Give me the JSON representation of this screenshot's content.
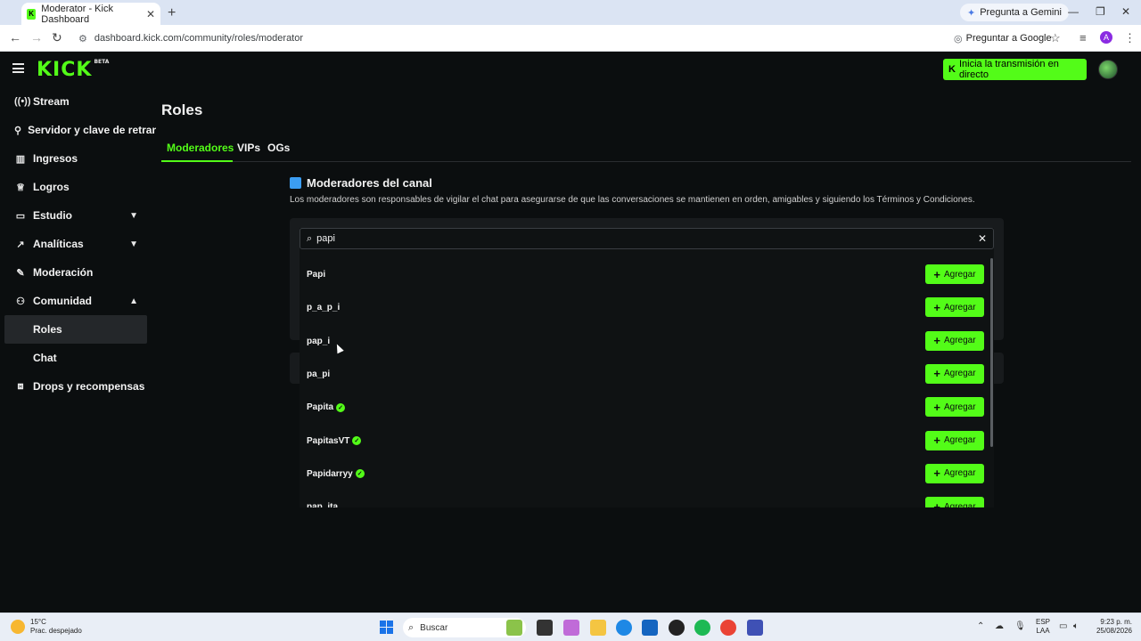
{
  "browser": {
    "tab_title": "Moderator - Kick Dashboard",
    "url": "dashboard.kick.com/community/roles/moderator",
    "gemini_label": "Pregunta a Gemini",
    "google_label": "Preguntar a Google",
    "profile_initial": "A"
  },
  "header": {
    "logo": "KICK",
    "logo_badge": "BETA",
    "stream_button": "Inicia la transmisión en directo"
  },
  "sidebar": {
    "items": [
      {
        "label": "Stream"
      },
      {
        "label": "Servidor y clave de retransmisión"
      },
      {
        "label": "Ingresos"
      },
      {
        "label": "Logros"
      },
      {
        "label": "Estudio"
      },
      {
        "label": "Analíticas"
      },
      {
        "label": "Moderación"
      },
      {
        "label": "Comunidad"
      }
    ],
    "sub_items": [
      {
        "label": "Roles"
      },
      {
        "label": "Chat"
      }
    ],
    "drops": "Drops y recompensas"
  },
  "main": {
    "title": "Roles",
    "tabs": [
      {
        "label": "Moderadores"
      },
      {
        "label": "VIPs"
      },
      {
        "label": "OGs"
      }
    ],
    "section_title": "Moderadores del canal",
    "section_desc": "Los moderadores son responsables de vigilar el chat para asegurarse de que las conversaciones se mantienen en orden, amigables y siguiendo los Términos y Condiciones."
  },
  "search": {
    "value": "papi"
  },
  "results": [
    {
      "name": "Papi",
      "verified": false
    },
    {
      "name": "p_a_p_i",
      "verified": false
    },
    {
      "name": "pap_i",
      "verified": false
    },
    {
      "name": "pa_pi",
      "verified": false
    },
    {
      "name": "Papita",
      "verified": true
    },
    {
      "name": "PapitasVT",
      "verified": true
    },
    {
      "name": "Papidarryy",
      "verified": true
    },
    {
      "name": "pap_ita",
      "verified": false
    }
  ],
  "add_label": "Agregar",
  "taskbar": {
    "temp": "15°C",
    "weather": "Prac. despejado",
    "search": "Buscar",
    "lang_top": "ESP",
    "lang_bottom": "LAA",
    "time": "9:23 p. m.",
    "date": "25/08/2026"
  },
  "colors": {
    "accent": "#53fc18",
    "background": "#0b0e0f",
    "panel": "#181b1d",
    "shield": "#3b9df2"
  }
}
